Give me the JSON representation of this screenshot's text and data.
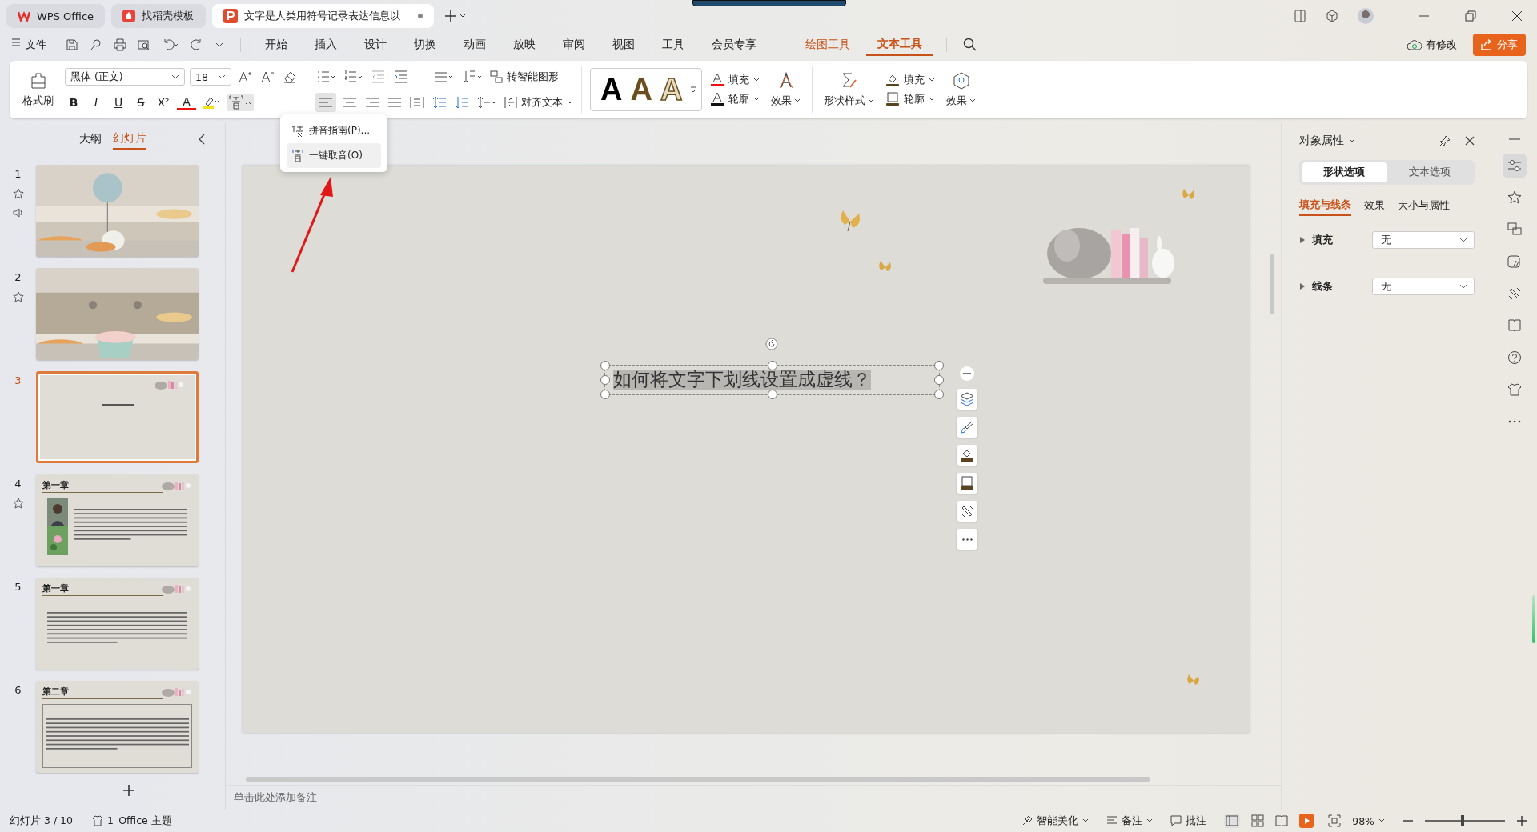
{
  "title_tabs": [
    {
      "label": "WPS Office",
      "selected": false,
      "kind": "wps"
    },
    {
      "label": "找稻壳模板",
      "selected": false,
      "kind": "docer"
    },
    {
      "label": "文字是人类用符号记录表达信息以",
      "selected": true,
      "kind": "ppt"
    }
  ],
  "menu": {
    "file": "文件",
    "tabs": [
      {
        "label": "开始",
        "selected": false,
        "kind": "normal"
      },
      {
        "label": "插入",
        "selected": false,
        "kind": "normal"
      },
      {
        "label": "设计",
        "selected": false,
        "kind": "normal"
      },
      {
        "label": "切换",
        "selected": false,
        "kind": "normal"
      },
      {
        "label": "动画",
        "selected": false,
        "kind": "normal"
      },
      {
        "label": "放映",
        "selected": false,
        "kind": "normal"
      },
      {
        "label": "审阅",
        "selected": false,
        "kind": "normal"
      },
      {
        "label": "视图",
        "selected": false,
        "kind": "normal"
      },
      {
        "label": "工具",
        "selected": false,
        "kind": "normal"
      },
      {
        "label": "会员专享",
        "selected": false,
        "kind": "normal"
      },
      {
        "label": "绘图工具",
        "selected": false,
        "kind": "context"
      },
      {
        "label": "文本工具",
        "selected": true,
        "kind": "context"
      }
    ],
    "cloud_status": "有修改",
    "share": "分享"
  },
  "ribbon": {
    "format_painter": "格式刷",
    "font": "黑体 (正文)",
    "size": "18",
    "format_buttons": [
      "B",
      "I",
      "U",
      "S",
      "X²",
      "A"
    ],
    "smart_shape": "转智能图形",
    "align_text": "对齐文本",
    "wordart": [
      "A",
      "A",
      "A"
    ],
    "text_fill": "填充",
    "text_outline": "轮廓",
    "text_effects": "效果",
    "shape_style": "形状样式",
    "shape_fill": "填充",
    "shape_outline": "轮廓",
    "shape_effects": "效果"
  },
  "pinyin_menu": [
    {
      "label": "拼音指南(P)...",
      "selected": false
    },
    {
      "label": "一键取音(O)",
      "selected": true
    }
  ],
  "slide_panel": {
    "tabs": [
      {
        "label": "大纲",
        "selected": false
      },
      {
        "label": "幻灯片",
        "selected": true
      }
    ],
    "slides": [
      {
        "number": "1",
        "selected": false,
        "starred": true,
        "sound": true
      },
      {
        "number": "2",
        "selected": false,
        "starred": true,
        "sound": false
      },
      {
        "number": "3",
        "selected": true,
        "kind": "title",
        "starred": false,
        "sound": false
      },
      {
        "number": "4",
        "selected": false,
        "kind": "text_photo",
        "heading": "第一章",
        "starred": true,
        "sound": false
      },
      {
        "number": "5",
        "selected": false,
        "kind": "text",
        "heading": "第一章",
        "starred": false,
        "sound": false
      },
      {
        "number": "6",
        "selected": false,
        "kind": "framed",
        "heading": "第二章",
        "starred": false,
        "sound": false
      }
    ]
  },
  "slide": {
    "text": "如何将文字下划线设置成虚线？"
  },
  "notes_placeholder": "单击此处添加备注",
  "properties": {
    "title": "对象属性",
    "tabs": [
      {
        "label": "形状选项",
        "selected": true
      },
      {
        "label": "文本选项",
        "selected": false
      }
    ],
    "subtabs": [
      {
        "label": "填充与线条",
        "selected": true
      },
      {
        "label": "效果",
        "selected": false
      },
      {
        "label": "大小与属性",
        "selected": false
      }
    ],
    "rows": [
      {
        "label": "填充",
        "value": "无"
      },
      {
        "label": "线条",
        "value": "无"
      }
    ]
  },
  "status": {
    "slide": "幻灯片 3 / 10",
    "theme": "1_Office 主题",
    "beautify": "智能美化",
    "notes": "备注",
    "comments": "批注",
    "zoom": "98%",
    "zoom_slider": {
      "level": 0.47
    }
  }
}
